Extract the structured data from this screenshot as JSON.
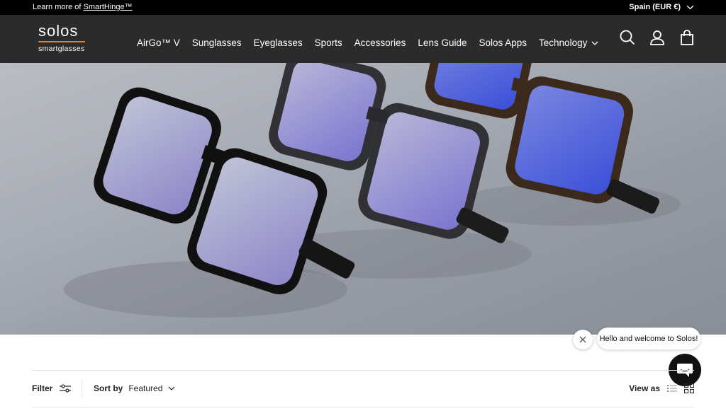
{
  "announcement": {
    "prefix": "Learn more of ",
    "link": "SmartHinge™",
    "region": "Spain (EUR €)"
  },
  "header": {
    "logo_word": "solos",
    "logo_sub": "smartglasses",
    "nav": [
      "AirGo™ V",
      "Sunglasses",
      "Eyeglasses",
      "Sports",
      "Accessories",
      "Lens Guide",
      "Solos Apps"
    ],
    "nav_dropdown": "Technology",
    "icons": [
      "search-icon",
      "account-icon",
      "cart-bag-icon"
    ]
  },
  "chat": {
    "message": "Hello and welcome to Solos!"
  },
  "toolbar": {
    "filter_label": "Filter",
    "sort_label": "Sort by",
    "sort_value": "Featured",
    "view_label": "View as"
  },
  "colors": {
    "brand_accent": "#e07b2a",
    "header_bg": "#2b2b2b",
    "announce_bg": "#000000"
  }
}
